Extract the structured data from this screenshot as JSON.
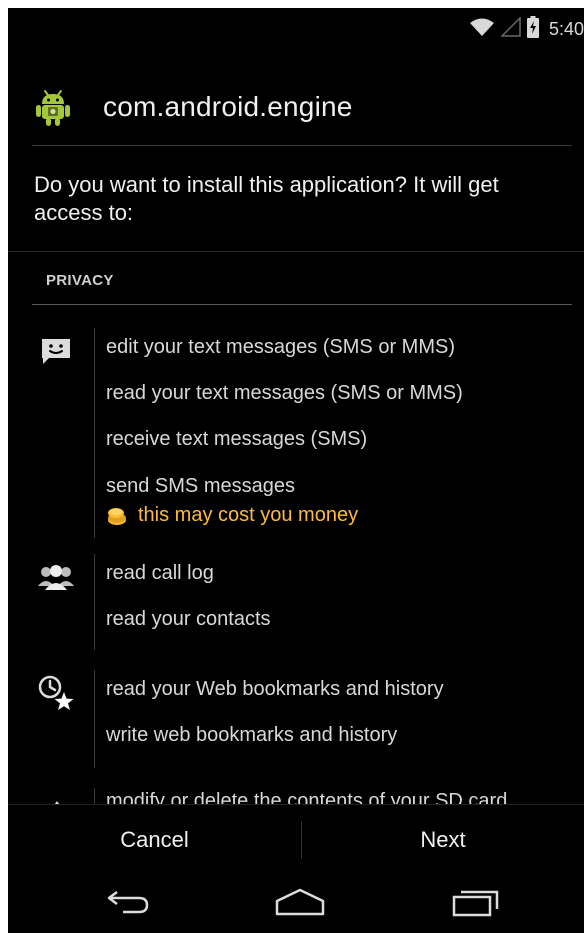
{
  "status_bar": {
    "time": "5:40",
    "icons": [
      "wifi-icon",
      "signal-icon",
      "battery-charging-icon"
    ]
  },
  "header": {
    "app_name": "com.android.engine",
    "icon": "android-robot-icon"
  },
  "prompt": {
    "text": "Do you want to install this application? It will get access to:"
  },
  "section": {
    "title": "PRIVACY"
  },
  "permission_groups": [
    {
      "icon": "sms-icon",
      "items": [
        "edit your text messages (SMS or MMS)",
        "read your text messages (SMS or MMS)",
        "receive text messages (SMS)",
        "send SMS messages"
      ],
      "warning": "this may cost you money"
    },
    {
      "icon": "contacts-icon",
      "items": [
        "read call log",
        "read your contacts"
      ]
    },
    {
      "icon": "bookmarks-icon",
      "items": [
        "read your Web bookmarks and history",
        "write web bookmarks and history"
      ]
    },
    {
      "icon": "storage-icon",
      "items": [
        "modify or delete the contents of your SD card"
      ]
    }
  ],
  "buttons": {
    "cancel": "Cancel",
    "next": "Next"
  },
  "nav": {
    "back": "back-icon",
    "home": "home-icon",
    "recents": "recents-icon"
  },
  "colors": {
    "background": "#000000",
    "text": "#f0f0f0",
    "warning": "#ffbb33",
    "divider": "#3a3a3a",
    "android_green": "#a4c639"
  }
}
